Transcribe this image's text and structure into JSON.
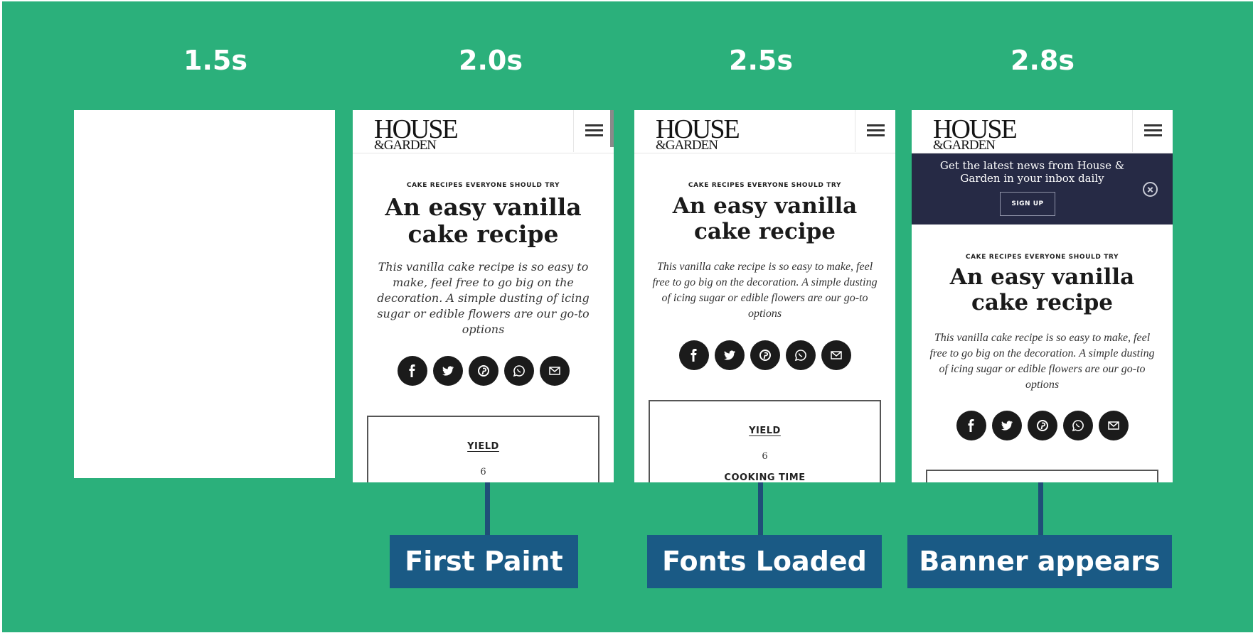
{
  "timeline": {
    "times": [
      "1.5s",
      "2.0s",
      "2.5s",
      "2.8s"
    ],
    "labels": [
      "First Paint",
      "Fonts Loaded",
      "Banner appears"
    ]
  },
  "page": {
    "logo_line1": "HOUSE",
    "logo_line2": "&GARDEN",
    "eyebrow": "CAKE RECIPES EVERYONE SHOULD TRY",
    "title": "An easy vanilla cake recipe",
    "standfirst": "This vanilla cake recipe is so easy to make, feel free to go big on the decoration. A simple dusting of icing sugar or edible flowers are our go-to options",
    "social_icons": [
      "facebook-icon",
      "twitter-icon",
      "pinterest-icon",
      "whatsapp-icon",
      "email-icon"
    ],
    "yield_label": "YIELD",
    "yield_value": "6",
    "cooking_time_label": "COOKING TIME"
  },
  "banner": {
    "message": "Get the latest news from House & Garden in your inbox daily",
    "signup_label": "SIGN UP"
  },
  "colors": {
    "background": "#2bb07b",
    "label_box": "#1a5a85",
    "banner": "#262a45"
  }
}
